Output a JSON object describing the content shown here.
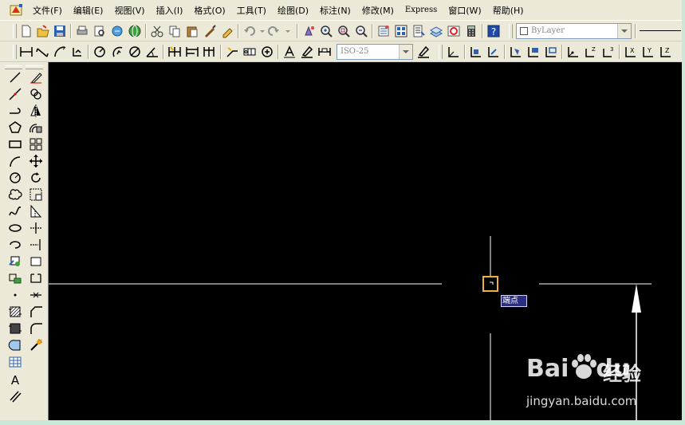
{
  "menubar": {
    "items": [
      {
        "label": "文件(F)"
      },
      {
        "label": "编辑(E)"
      },
      {
        "label": "视图(V)"
      },
      {
        "label": "插入(I)"
      },
      {
        "label": "格式(O)"
      },
      {
        "label": "工具(T)"
      },
      {
        "label": "绘图(D)"
      },
      {
        "label": "标注(N)"
      },
      {
        "label": "修改(M)"
      },
      {
        "label": "Express"
      },
      {
        "label": "窗口(W)"
      },
      {
        "label": "帮助(H)"
      }
    ]
  },
  "toolbar1": {
    "layer_combo": "ByLayer"
  },
  "toolbar2": {
    "dimstyle_combo": "ISO-25"
  },
  "canvas": {
    "snap_tooltip": "端点",
    "background": "#000000",
    "line_color": "#ffffff",
    "snap_marker_color": "#f0b040"
  },
  "watermark": {
    "brand": "Bai",
    "brand2": "du",
    "product": "经验",
    "url": "jingyan.baidu.com"
  },
  "colors": {
    "chrome": "#ece9d8",
    "border_outer": "#c8e8d8"
  }
}
